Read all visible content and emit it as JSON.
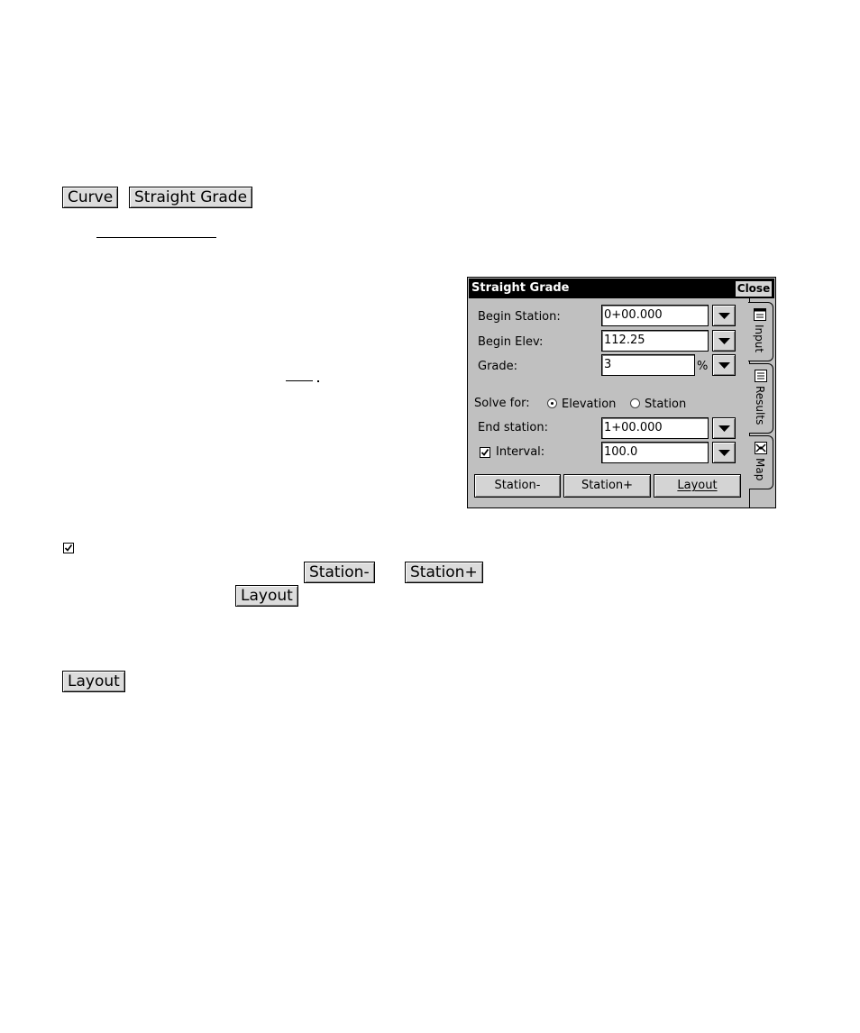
{
  "top_buttons": {
    "curve": "Curve",
    "straight_grade": "Straight Grade"
  },
  "inline_buttons": {
    "station_minus": "Station-",
    "station_plus": "Station+",
    "layout": "Layout"
  },
  "bottom_button": "Layout",
  "dialog": {
    "title": "Straight Grade",
    "close": "Close",
    "fields": {
      "begin_station": {
        "label": "Begin Station:",
        "value": "0+00.000"
      },
      "begin_elev": {
        "label": "Begin Elev:",
        "value": "112.25"
      },
      "grade": {
        "label": "Grade:",
        "value": "3",
        "unit": "%"
      },
      "end_station": {
        "label": "End station:",
        "value": "1+00.000"
      },
      "interval": {
        "label": "Interval:",
        "value": "100.0",
        "checked": true
      }
    },
    "solve_for": {
      "label": "Solve for:",
      "options": [
        "Elevation",
        "Station"
      ],
      "selected": "Elevation"
    },
    "buttons": {
      "station_minus": "Station-",
      "station_plus": "Station+",
      "layout": "Layout"
    },
    "tabs": [
      "Input",
      "Results",
      "Map"
    ],
    "active_tab": "Input"
  },
  "icons": [
    "checkbox-checked-icon",
    "dropdown-arrow-icon",
    "input-tab-icon",
    "results-tab-icon",
    "map-tab-icon",
    "radio-selected-icon"
  ]
}
